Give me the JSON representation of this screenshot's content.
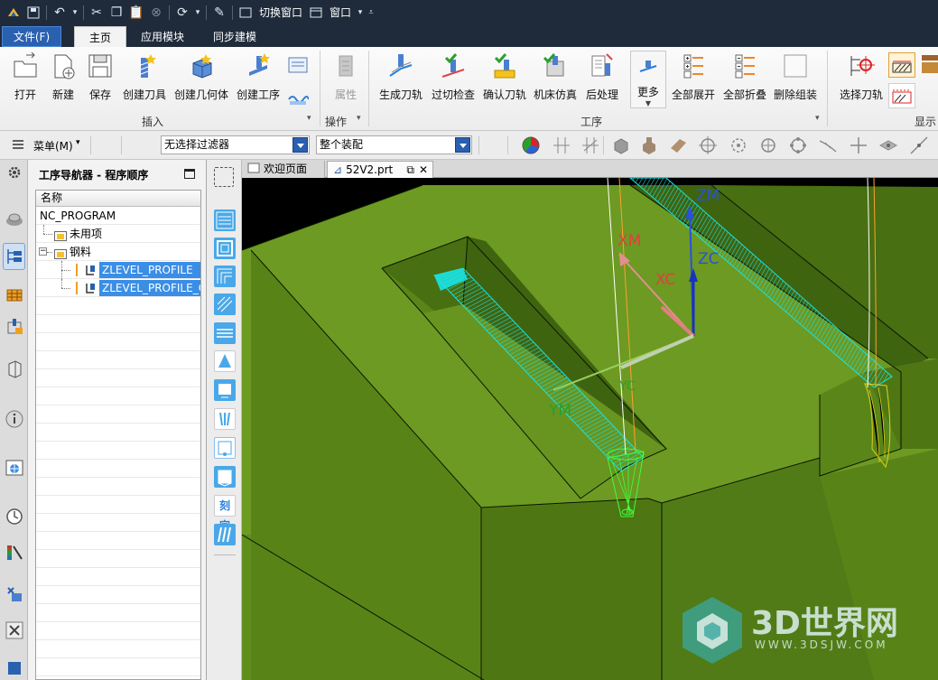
{
  "titlebar": {
    "switch_window": "切换窗口",
    "window_menu": "窗口"
  },
  "menu": {
    "file": "文件(F)",
    "tabs": [
      "主页",
      "应用模块",
      "同步建模"
    ]
  },
  "ribbon": {
    "buttons": [
      "打开",
      "新建",
      "保存",
      "创建刀具",
      "创建几何体",
      "创建工序",
      "属性",
      "生成刀轨",
      "过切检查",
      "确认刀轨",
      "机床仿真",
      "后处理",
      "更多",
      "全部展开",
      "全部折叠",
      "删除组装",
      "选择刀轨"
    ],
    "groups": [
      "插入",
      "操作",
      "工序",
      "显示"
    ]
  },
  "toolbar": {
    "menu_label": "菜单(M)",
    "filter_value": "无选择过滤器",
    "assembly_value": "整个装配"
  },
  "navigator": {
    "title": "工序导航器 - 程序顺序",
    "column": "名称",
    "rows": [
      "NC_PROGRAM",
      "未用项",
      "钢料",
      "ZLEVEL_PROFILE",
      "ZLEVEL_PROFILE_CO"
    ]
  },
  "viewport": {
    "tabs": [
      "欢迎页面",
      "52V2.prt"
    ],
    "axes": {
      "zm": "ZM",
      "zc": "ZC",
      "xm": "XM",
      "xc": "XC",
      "ym": "YM",
      "yc": "YC"
    },
    "watermark_title": "3D世界网",
    "watermark_url": "WWW.3DSJW.COM"
  },
  "colors": {
    "titlebar": "#1f2b3a",
    "file_tab": "#2a60b0",
    "part_green": "#5f8e1c",
    "toolpath_cyan": "#19e3e3",
    "selection_blue": "#3a8ee6"
  }
}
